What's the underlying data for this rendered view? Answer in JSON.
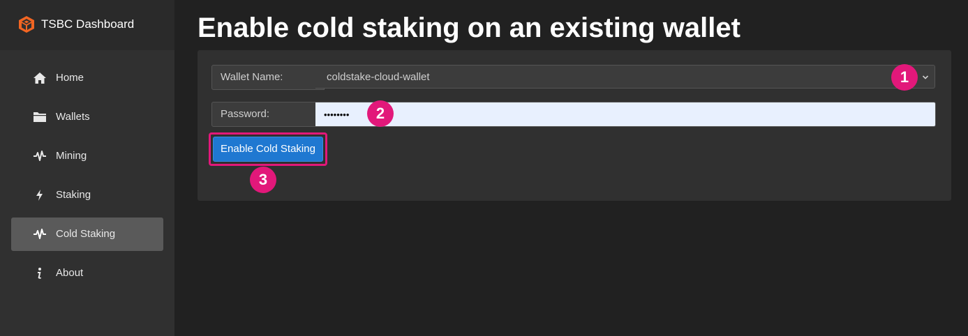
{
  "brand": {
    "title": "TSBC Dashboard",
    "logo_icon": "cube-logo-icon",
    "logo_color": "#f26522"
  },
  "sidebar": {
    "items": [
      {
        "label": "Home",
        "icon": "home-icon",
        "active": false
      },
      {
        "label": "Wallets",
        "icon": "folder-icon",
        "active": false
      },
      {
        "label": "Mining",
        "icon": "pulse-icon",
        "active": false
      },
      {
        "label": "Staking",
        "icon": "lightning-icon",
        "active": false
      },
      {
        "label": "Cold Staking",
        "icon": "pulse-icon",
        "active": true
      },
      {
        "label": "About",
        "icon": "info-icon",
        "active": false
      }
    ]
  },
  "page": {
    "title": "Enable cold staking on an existing wallet"
  },
  "form": {
    "wallet_name_label": "Wallet Name:",
    "wallet_name_value": "coldstake-cloud-wallet",
    "password_label": "Password:",
    "password_value": "••••••••",
    "submit_label": "Enable Cold Staking"
  },
  "markers": [
    "1",
    "2",
    "3"
  ],
  "colors": {
    "accent": "#1f78d1",
    "highlight": "#e2187a",
    "sidebar_bg": "#303030",
    "page_bg": "#212121"
  }
}
